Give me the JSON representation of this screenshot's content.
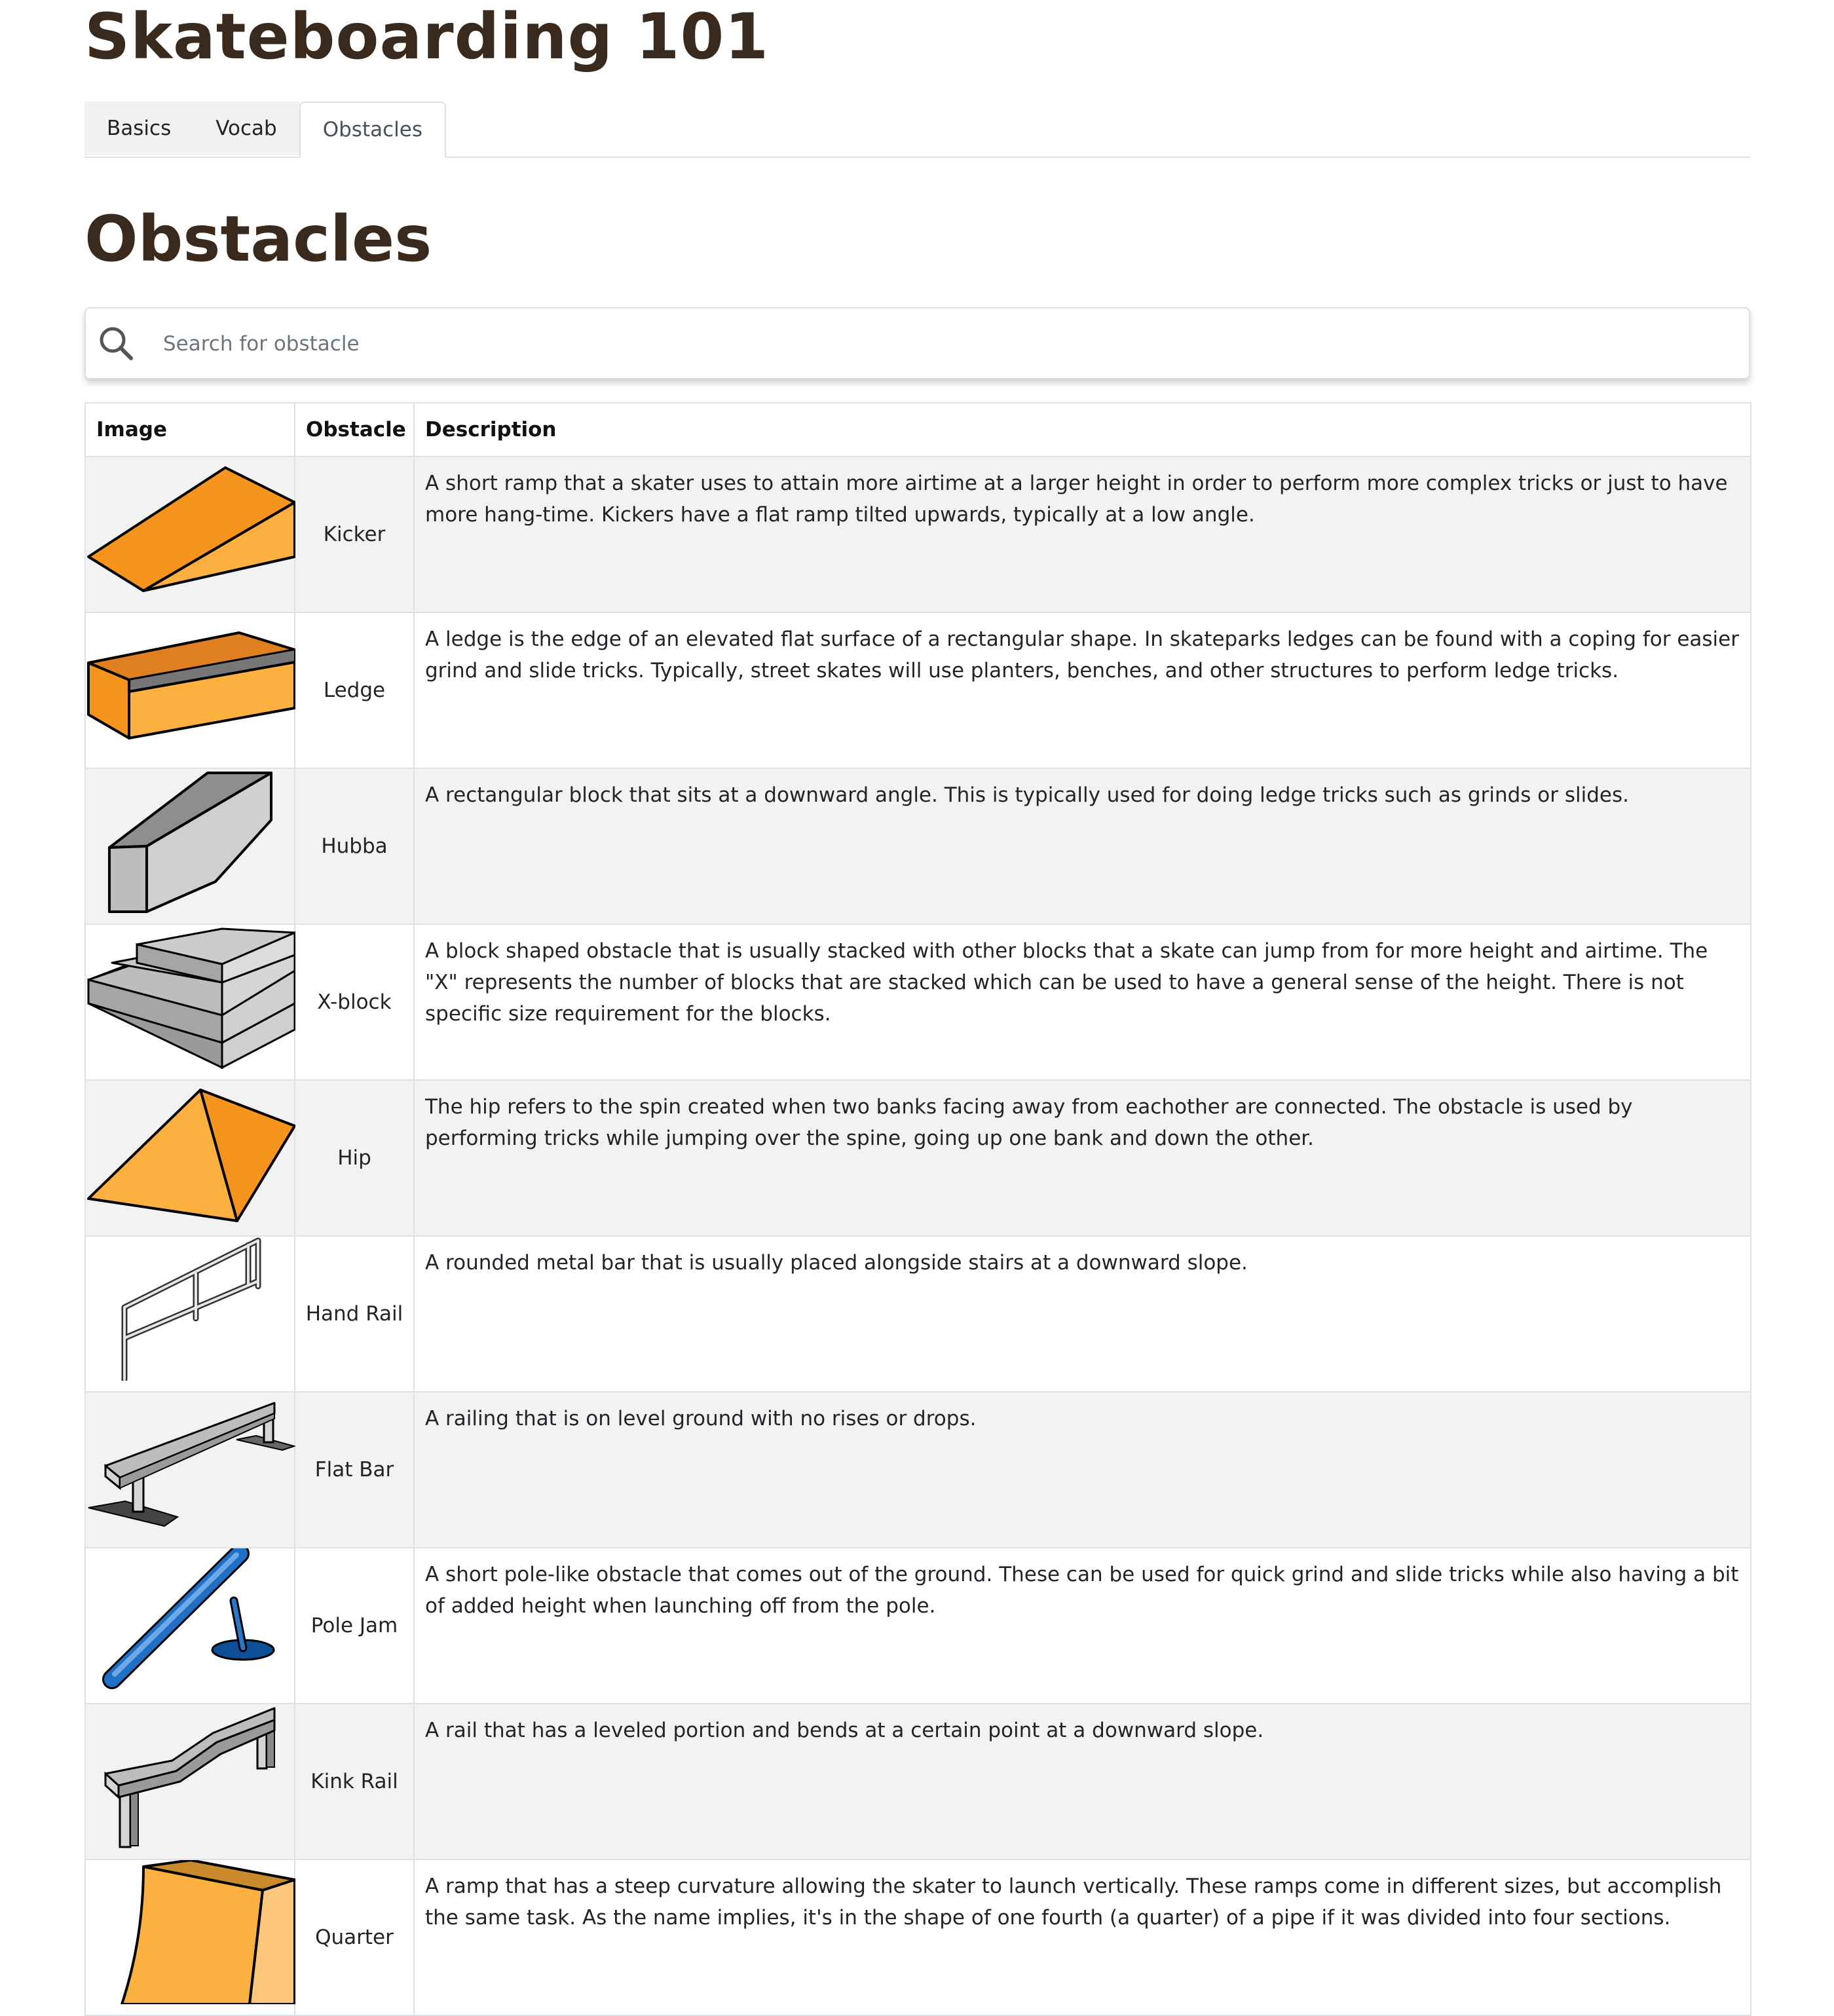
{
  "header": {
    "title": "Skateboarding 101"
  },
  "tabs": [
    {
      "label": "Basics"
    },
    {
      "label": "Vocab"
    },
    {
      "label": "Obstacles",
      "active": true
    }
  ],
  "section": {
    "title": "Obstacles"
  },
  "search": {
    "placeholder": "Search for obstacle",
    "value": "",
    "icon": "search-icon"
  },
  "table": {
    "columns": [
      "Image",
      "Obstacle",
      "Description"
    ],
    "rows": [
      {
        "name": "Kicker",
        "image": "kicker-image",
        "description": "A short ramp that a skater uses to attain more airtime at a larger height in order to perform more complex tricks or just to have more hang-time. Kickers have a flat ramp tilted upwards, typically at a low angle."
      },
      {
        "name": "Ledge",
        "image": "ledge-image",
        "description": "A ledge is the edge of an elevated flat surface of a rectangular shape. In skateparks ledges can be found with a coping for easier grind and slide tricks. Typically, street skates will use planters, benches, and other structures to perform ledge tricks."
      },
      {
        "name": "Hubba",
        "image": "hubba-image",
        "description": "A rectangular block that sits at a downward angle. This is typically used for doing ledge tricks such as grinds or slides."
      },
      {
        "name": "X-block",
        "image": "x-block-image",
        "description": "A block shaped obstacle that is usually stacked with other blocks that a skate can jump from for more height and airtime. The \"X\" represents the number of blocks that are stacked which can be used to have a general sense of the height. There is not specific size requirement for the blocks."
      },
      {
        "name": "Hip",
        "image": "hip-image",
        "description": "The hip refers to the spin created when two banks facing away from eachother are connected. The obstacle is used by performing tricks while jumping over the spine, going up one bank and down the other."
      },
      {
        "name": "Hand Rail",
        "image": "hand-rail-image",
        "description": "A rounded metal bar that is usually placed alongside stairs at a downward slope."
      },
      {
        "name": "Flat Bar",
        "image": "flat-bar-image",
        "description": "A railing that is on level ground with no rises or drops."
      },
      {
        "name": "Pole Jam",
        "image": "pole-jam-image",
        "description": "A short pole-like obstacle that comes out of the ground. These can be used for quick grind and slide tricks while also having a bit of added height when launching off from the pole."
      },
      {
        "name": "Kink Rail",
        "image": "kink-rail-image",
        "description": "A rail that has a leveled portion and bends at a certain point at a downward slope."
      },
      {
        "name": "Quarter",
        "image": "quarter-pipe-image",
        "description": "A ramp that has a steep curvature allowing the skater to launch vertically. These ramps come in different sizes, but accomplish the same task. As the name implies, it's in the shape of one fourth (a quarter) of a pipe if it was divided into four sections."
      }
    ]
  },
  "colors": {
    "heading": "#3a2a1d",
    "orange": "#f7941d",
    "orange_light": "#fbb040",
    "gray_block": "#c8c8c8",
    "blue_pole": "#1f6fc5",
    "row_stripe": "#f2f2f2"
  }
}
